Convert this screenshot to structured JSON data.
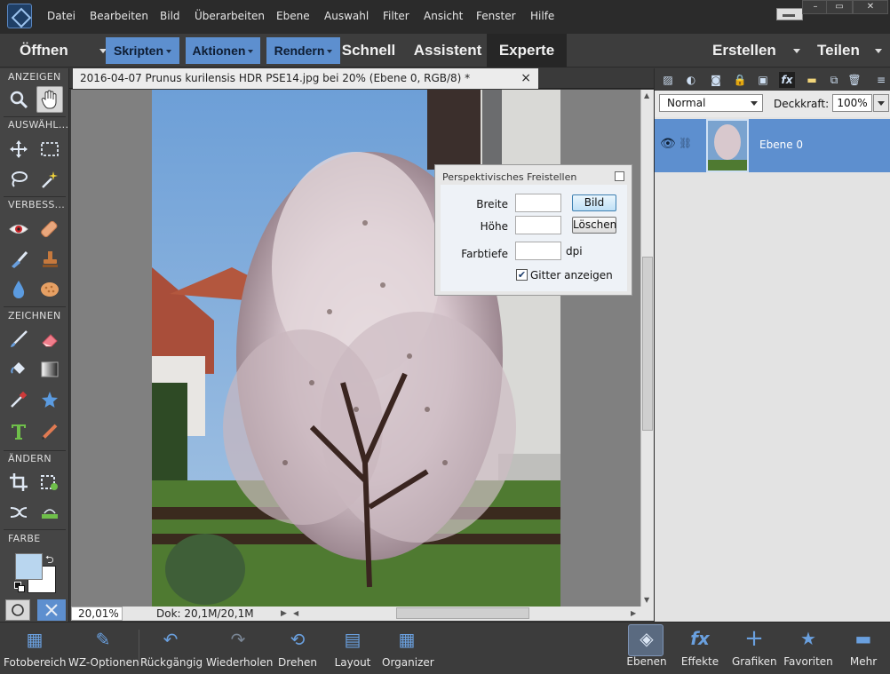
{
  "menubar": {
    "items": [
      "Datei",
      "Bearbeiten",
      "Bild",
      "Überarbeiten",
      "Ebene",
      "Auswahl",
      "Filter",
      "Ansicht",
      "Fenster",
      "Hilfe"
    ],
    "window_buttons": [
      "–",
      "▭",
      "✕"
    ]
  },
  "modebar": {
    "open_label": "Öffnen",
    "scripts_label": "Skripten",
    "actions_label": "Aktionen",
    "render_label": "Rendern",
    "quick_label": "Schnell",
    "guided_label": "Assistent",
    "expert_label": "Experte",
    "create_label": "Erstellen",
    "share_label": "Teilen"
  },
  "toolbox": {
    "sections": [
      "ANZEIGEN",
      "AUSWÄHL...",
      "VERBESS...",
      "ZEICHNEN",
      "ÄNDERN",
      "FARBE"
    ],
    "colors": {
      "foreground": "#b9d6ef",
      "background": "#ffffff"
    }
  },
  "document": {
    "tab_title": "2016-04-07 Prunus kurilensis HDR PSE14.jpg bei 20% (Ebene 0, RGB/8) *",
    "close_glyph": "×",
    "zoom": "20,01%",
    "doc_info": "Dok: 20,1M/20,1M"
  },
  "dialog": {
    "title": "Perspektivisches Freistellen",
    "width_label": "Breite",
    "height_label": "Höhe",
    "depth_label": "Farbtiefe",
    "depth_unit": "dpi",
    "image_button": "Bild",
    "clear_button": "Löschen",
    "grid_label": "Gitter anzeigen",
    "grid_checked": true
  },
  "layers_panel": {
    "blend_mode": "Normal",
    "opacity_label": "Deckkraft:",
    "opacity_value": "100%",
    "layer_name": "Ebene 0"
  },
  "taskbar": {
    "items": [
      "Fotobereich",
      "WZ-Optionen",
      "Rückgängig",
      "Wiederholen",
      "Drehen",
      "Layout",
      "Organizer",
      "Ebenen",
      "Effekte",
      "Grafiken",
      "Favoriten",
      "Mehr"
    ]
  },
  "colors": {
    "accent": "#5d8fcf",
    "chrome_dark": "#2b2b2b",
    "panel_light": "#e3e3e3"
  }
}
